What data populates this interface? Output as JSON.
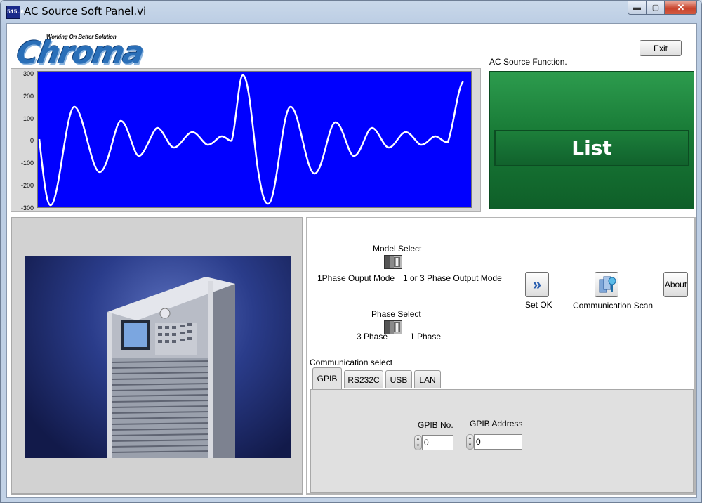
{
  "window": {
    "title": "AC Source Soft Panel.vi",
    "app_icon_text": "515.6",
    "controls": {
      "minimize": "▬",
      "maximize": "▢",
      "close": "✕"
    }
  },
  "logo": {
    "brand": "Chroma",
    "tagline": "Working On Better Solution"
  },
  "header": {
    "exit_label": "Exit"
  },
  "waveform": {
    "y_ticks": [
      "300",
      "200",
      "100",
      "0",
      "-100",
      "-200",
      "-300"
    ],
    "ylim": [
      -300,
      300
    ],
    "trace_color": "#ffffff",
    "plot_color": "#0000ff"
  },
  "function_panel": {
    "label": "AC Source Function.",
    "value": "List"
  },
  "controls": {
    "model_select": {
      "title": "Model Select",
      "left_option": "1Phase Ouput Mode",
      "right_option": "1 or 3 Phase Output Mode"
    },
    "phase_select": {
      "title": "Phase Select",
      "left_option": "3 Phase",
      "right_option": "1 Phase"
    },
    "set_ok_label": "Set OK",
    "comm_scan_label": "Communication Scan",
    "about_label": "About",
    "comm_select_label": "Communication select",
    "tabs": [
      "GPIB",
      "RS232C",
      "USB",
      "LAN"
    ],
    "active_tab": "GPIB",
    "gpib_no": {
      "label": "GPIB No.",
      "value": "0"
    },
    "gpib_address": {
      "label": "GPIB Address",
      "value": "0"
    }
  }
}
